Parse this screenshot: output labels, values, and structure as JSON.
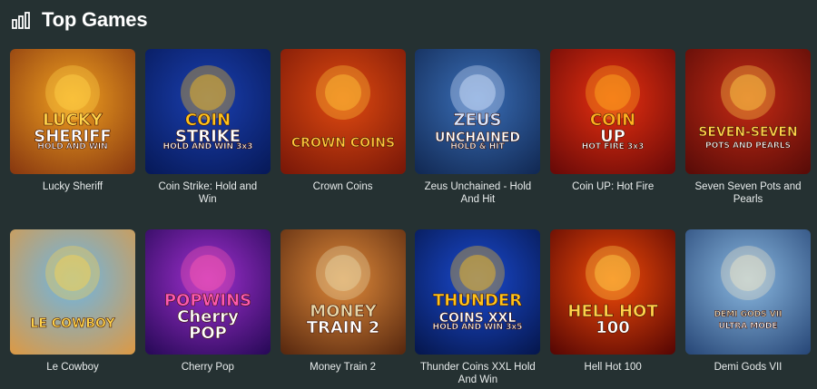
{
  "header": {
    "title": "Top Games",
    "icon": "bar-chart-icon"
  },
  "games": [
    {
      "name": "Lucky Sheriff",
      "logo_lines": [
        "LUCKY",
        "SHERIFF",
        "HOLD AND WIN"
      ],
      "bg": [
        "#f0a020",
        "#8a3a10"
      ],
      "accent": "#ffd34a"
    },
    {
      "name": "Coin Strike: Hold and Win",
      "logo_lines": [
        "COIN",
        "STRIKE",
        "HOLD AND WIN 3x3"
      ],
      "bg": [
        "#1a3fb0",
        "#071a5a"
      ],
      "accent": "#ffc21a"
    },
    {
      "name": "Crown Coins",
      "logo_lines": [
        "CROWN COINS"
      ],
      "bg": [
        "#e04a10",
        "#7a1808"
      ],
      "accent": "#ffc53a"
    },
    {
      "name": "Zeus Unchained - Hold And Hit",
      "logo_lines": [
        "ZEUS",
        "UNCHAINED",
        "HOLD & HIT"
      ],
      "bg": [
        "#3a6fb8",
        "#122a55"
      ],
      "accent": "#d8e6ff"
    },
    {
      "name": "Coin UP: Hot Fire",
      "logo_lines": [
        "COIN",
        "UP",
        "HOT FIRE 3x3"
      ],
      "bg": [
        "#e83010",
        "#6a0a08"
      ],
      "accent": "#ffb020"
    },
    {
      "name": "Seven Seven Pots and Pearls",
      "logo_lines": [
        "SEVEN-SEVEN",
        "POTS AND PEARLS"
      ],
      "bg": [
        "#c42a14",
        "#5a0c08"
      ],
      "accent": "#ffd24a"
    },
    {
      "name": "Le Cowboy",
      "logo_lines": [
        "LE COWBOY"
      ],
      "bg": [
        "#6cb6e6",
        "#d89a4a"
      ],
      "accent": "#ffd34a"
    },
    {
      "name": "Cherry Pop",
      "logo_lines": [
        "POPWINS",
        "Cherry",
        "POP"
      ],
      "bg": [
        "#a030d0",
        "#2a0a5a"
      ],
      "accent": "#ff5ab0"
    },
    {
      "name": "Money Train 2",
      "logo_lines": [
        "MONEY",
        "TRAIN 2"
      ],
      "bg": [
        "#e08a3a",
        "#5a2a10"
      ],
      "accent": "#e6d6a8"
    },
    {
      "name": "Thunder Coins XXL Hold And Win",
      "logo_lines": [
        "THUNDER",
        "COINS XXL",
        "HOLD AND WIN 3x5"
      ],
      "bg": [
        "#1a4ad0",
        "#061850"
      ],
      "accent": "#ffc21a"
    },
    {
      "name": "Hell Hot 100",
      "logo_lines": [
        "HELL HOT",
        "100"
      ],
      "bg": [
        "#f04a08",
        "#5a0804"
      ],
      "accent": "#ffd24a"
    },
    {
      "name": "Demi Gods VII",
      "logo_lines": [
        "DEMI GODS VII",
        "ULTRA MODE"
      ],
      "bg": [
        "#8ab8e0",
        "#2a4a7a"
      ],
      "accent": "#f0e6c8"
    }
  ]
}
